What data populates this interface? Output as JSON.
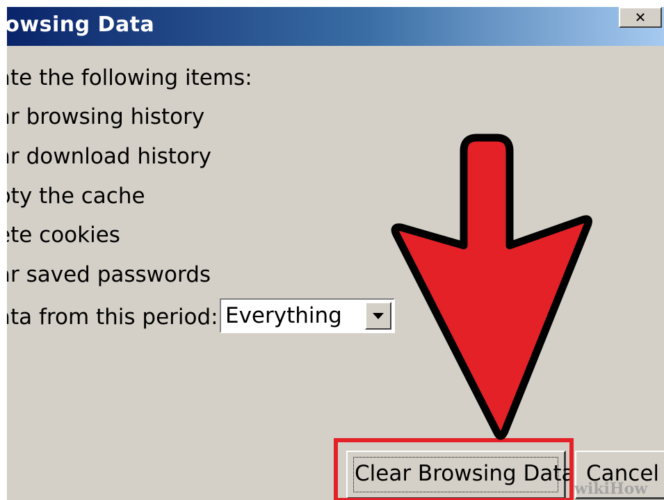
{
  "window": {
    "title": "rowsing Data",
    "close_glyph": "✕"
  },
  "content": {
    "intro": "ate the following items:",
    "items": [
      "ar browsing history",
      "ar download history",
      "pty the cache",
      "ete cookies",
      "ar saved passwords"
    ],
    "period_label": "ata from this period:",
    "period_value": "Everything"
  },
  "buttons": {
    "clear_label": "Clear Browsing Data",
    "cancel_label": "Cancel"
  },
  "overlay": {
    "arrow_icon": "down-arrow-icon",
    "arrow_color": "#e32127",
    "highlight_color": "#e32127",
    "watermark": "wikiHow"
  },
  "colors": {
    "dialog_bg": "#d4d0c8",
    "title_start": "#0a246a",
    "title_end": "#a6caf0"
  }
}
